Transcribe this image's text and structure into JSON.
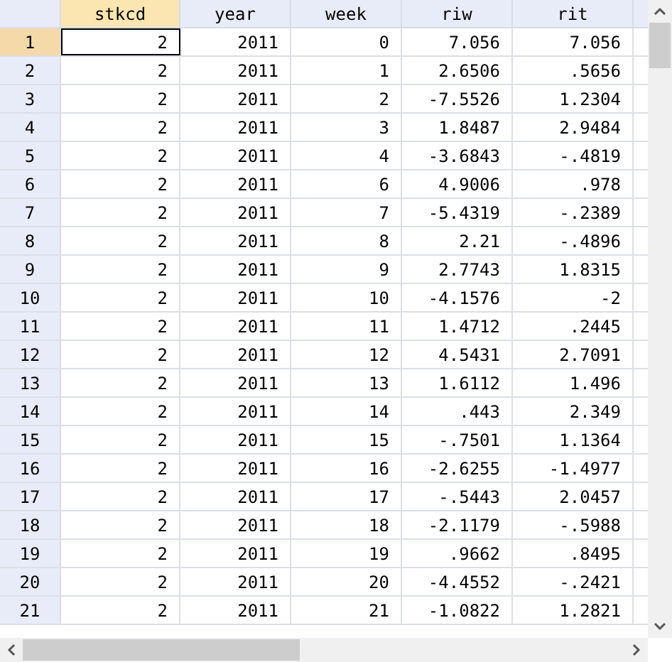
{
  "columns": [
    {
      "label": "stkcd",
      "selected": true
    },
    {
      "label": "year",
      "selected": false
    },
    {
      "label": "week",
      "selected": false
    },
    {
      "label": "riw",
      "selected": false
    },
    {
      "label": "rit",
      "selected": false
    }
  ],
  "rows": [
    {
      "number": "1",
      "selected": true,
      "cells": [
        "2",
        "2011",
        "0",
        "7.056",
        "7.056"
      ]
    },
    {
      "number": "2",
      "selected": false,
      "cells": [
        "2",
        "2011",
        "1",
        "2.6506",
        ".5656"
      ]
    },
    {
      "number": "3",
      "selected": false,
      "cells": [
        "2",
        "2011",
        "2",
        "-7.5526",
        "1.2304"
      ]
    },
    {
      "number": "4",
      "selected": false,
      "cells": [
        "2",
        "2011",
        "3",
        "1.8487",
        "2.9484"
      ]
    },
    {
      "number": "5",
      "selected": false,
      "cells": [
        "2",
        "2011",
        "4",
        "-3.6843",
        "-.4819"
      ]
    },
    {
      "number": "6",
      "selected": false,
      "cells": [
        "2",
        "2011",
        "6",
        "4.9006",
        ".978"
      ]
    },
    {
      "number": "7",
      "selected": false,
      "cells": [
        "2",
        "2011",
        "7",
        "-5.4319",
        "-.2389"
      ]
    },
    {
      "number": "8",
      "selected": false,
      "cells": [
        "2",
        "2011",
        "8",
        "2.21",
        "-.4896"
      ]
    },
    {
      "number": "9",
      "selected": false,
      "cells": [
        "2",
        "2011",
        "9",
        "2.7743",
        "1.8315"
      ]
    },
    {
      "number": "10",
      "selected": false,
      "cells": [
        "2",
        "2011",
        "10",
        "-4.1576",
        "-2"
      ]
    },
    {
      "number": "11",
      "selected": false,
      "cells": [
        "2",
        "2011",
        "11",
        "1.4712",
        ".2445"
      ]
    },
    {
      "number": "12",
      "selected": false,
      "cells": [
        "2",
        "2011",
        "12",
        "4.5431",
        "2.7091"
      ]
    },
    {
      "number": "13",
      "selected": false,
      "cells": [
        "2",
        "2011",
        "13",
        "1.6112",
        "1.496"
      ]
    },
    {
      "number": "14",
      "selected": false,
      "cells": [
        "2",
        "2011",
        "14",
        ".443",
        "2.349"
      ]
    },
    {
      "number": "15",
      "selected": false,
      "cells": [
        "2",
        "2011",
        "15",
        "-.7501",
        "1.1364"
      ]
    },
    {
      "number": "16",
      "selected": false,
      "cells": [
        "2",
        "2011",
        "16",
        "-2.6255",
        "-1.4977"
      ]
    },
    {
      "number": "17",
      "selected": false,
      "cells": [
        "2",
        "2011",
        "17",
        "-.5443",
        "2.0457"
      ]
    },
    {
      "number": "18",
      "selected": false,
      "cells": [
        "2",
        "2011",
        "18",
        "-2.1179",
        "-.5988"
      ]
    },
    {
      "number": "19",
      "selected": false,
      "cells": [
        "2",
        "2011",
        "19",
        ".9662",
        ".8495"
      ]
    },
    {
      "number": "20",
      "selected": false,
      "cells": [
        "2",
        "2011",
        "20",
        "-4.4552",
        "-.2421"
      ]
    },
    {
      "number": "21",
      "selected": false,
      "cells": [
        "2",
        "2011",
        "21",
        "-1.0822",
        "1.2821"
      ]
    }
  ]
}
